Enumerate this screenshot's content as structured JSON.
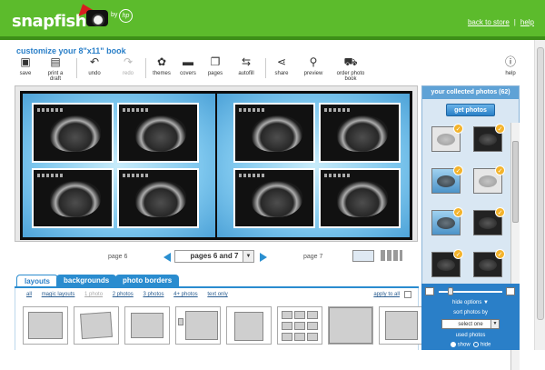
{
  "brand": {
    "logo": "snapfish",
    "by": "by",
    "hp": "hp"
  },
  "top_links": {
    "back": "back to store",
    "sep": "|",
    "help": "help"
  },
  "page_title": "customize your 8\"x11\" book",
  "toolbar": {
    "save": "save",
    "print_draft": "print a draft",
    "undo": "undo",
    "redo": "redo",
    "themes": "themes",
    "covers": "covers",
    "pages": "pages",
    "autofill": "autofill",
    "share": "share",
    "preview": "preview",
    "order": "order photo book",
    "help": "help"
  },
  "pagenav": {
    "left_label": "page 6",
    "selected": "pages 6 and 7",
    "right_label": "page 7"
  },
  "tabs": {
    "layouts": "layouts",
    "backgrounds": "backgrounds",
    "photo_borders": "photo borders"
  },
  "filters": [
    "all",
    "magic layouts",
    "1 photo",
    "2 photos",
    "3 photos",
    "4+ photos",
    "text only"
  ],
  "apply_all": "apply to all",
  "sidebar": {
    "header": "your collected photos (62)",
    "get_photos": "get photos",
    "hide_options": "hide options",
    "sort_by": "sort photos by",
    "sort_value": "select one",
    "used_photos": "used photos",
    "show": "show",
    "hide": "hide"
  }
}
